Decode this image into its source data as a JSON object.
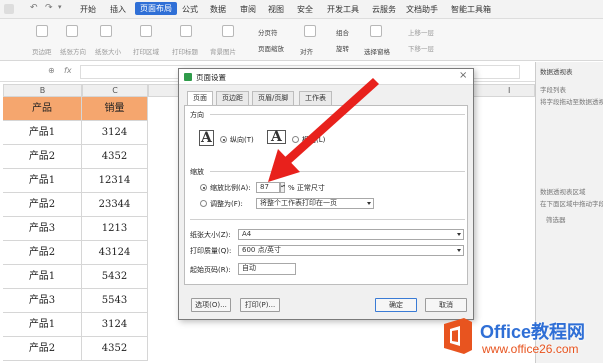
{
  "menu": {
    "items": [
      "开始",
      "插入",
      "页面布局",
      "公式",
      "数据",
      "审阅",
      "视图",
      "安全",
      "开发工具",
      "云服务",
      "文档助手",
      "智能工具箱"
    ],
    "active_index": 2
  },
  "ribbon": {
    "labels": [
      "页边距",
      "纸张方向",
      "纸张大小",
      "打印区域",
      "打印标题",
      "背景图片",
      "分页符",
      "页面缩放",
      "对齐",
      "组合",
      "旋转",
      "选择窗格",
      "上移一层",
      "下移一层"
    ]
  },
  "formula_bar": {
    "fx": "fx"
  },
  "sheet": {
    "columns": [
      "B",
      "C"
    ],
    "header": {
      "product": "产品",
      "sales": "销量"
    },
    "rows": [
      {
        "product": "产品1",
        "sales": "3124"
      },
      {
        "product": "产品2",
        "sales": "4352"
      },
      {
        "product": "产品1",
        "sales": "12314"
      },
      {
        "product": "产品2",
        "sales": "23344"
      },
      {
        "product": "产品3",
        "sales": "1213"
      },
      {
        "product": "产品2",
        "sales": "43124"
      },
      {
        "product": "产品1",
        "sales": "5432"
      },
      {
        "product": "产品3",
        "sales": "5543"
      },
      {
        "product": "产品1",
        "sales": "3124"
      },
      {
        "product": "产品2",
        "sales": "4352"
      }
    ],
    "col_i": "I"
  },
  "right_panel": {
    "title": "数据透视表",
    "field_list": "字段列表",
    "hint": "将字段拖动至数据透视表区域",
    "area": "数据透视表区域",
    "area_hint": "在下面区域中拖动字段",
    "filter": "筛选器"
  },
  "dialog": {
    "title": "页面设置",
    "tabs": [
      "页面",
      "页边距",
      "页眉/页脚",
      "工作表"
    ],
    "active_tab": 0,
    "orientation_label": "方向",
    "portrait": "纵向(T)",
    "landscape": "横向(L)",
    "scaling_label": "缩放",
    "scale_option": "缩放比例(A):",
    "scale_value": "87",
    "scale_suffix": "% 正常尺寸",
    "fit_option": "调整为(F):",
    "fit_value": "将整个工作表打印在一页",
    "paper_size_label": "纸张大小(Z):",
    "paper_size_value": "A4",
    "print_quality_label": "打印质量(Q):",
    "print_quality_value": "600 点/英寸",
    "first_page_label": "起始页码(R):",
    "first_page_value": "自动",
    "options_btn": "选项(O)...",
    "print_btn": "打印(P)...",
    "ok_btn": "确定",
    "cancel_btn": "取消"
  },
  "watermark": {
    "brand": "Office教程网",
    "url": "www.office26.com"
  },
  "colors": {
    "accent": "#2f6fd6",
    "header_fill": "#f5a66e",
    "arrow": "#e8211c",
    "logo_orange": "#e8541f"
  }
}
